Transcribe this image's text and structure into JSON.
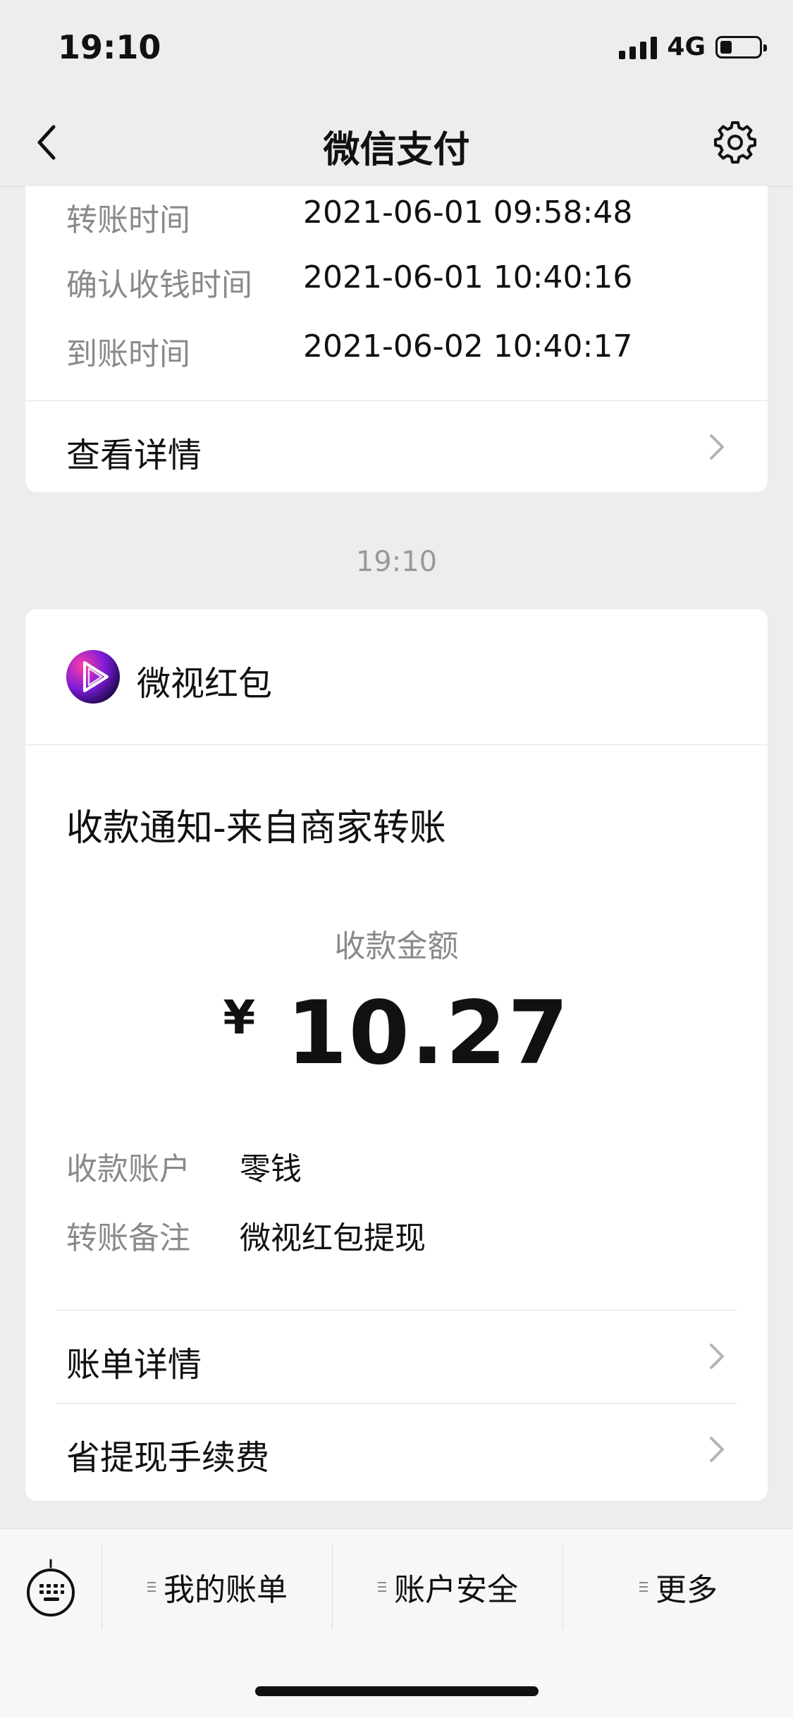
{
  "status_bar": {
    "time": "19:10",
    "network": "4G"
  },
  "nav": {
    "title": "微信支付"
  },
  "card1": {
    "partial_row": {
      "label": "转账时间",
      "value": "2021-06-01 09:58:48"
    },
    "rows": [
      {
        "label": "确认收钱时间",
        "value": "2021-06-01 10:40:16"
      },
      {
        "label": "到账时间",
        "value": "2021-06-02 10:40:17"
      }
    ],
    "link_label": "查看详情"
  },
  "timestamp": "19:10",
  "card2": {
    "brand": "微视红包",
    "notice_title": "收款通知-来自商家转账",
    "amount_label": "收款金额",
    "currency": "¥",
    "amount": "10.27",
    "details": [
      {
        "label": "收款账户",
        "value": "零钱"
      },
      {
        "label": "转账备注",
        "value": "微视红包提现"
      }
    ],
    "links": [
      {
        "label": "账单详情"
      },
      {
        "label": "省提现手续费"
      }
    ]
  },
  "bottom_bar": {
    "tabs": [
      {
        "label": "我的账单"
      },
      {
        "label": "账户安全"
      },
      {
        "label": "更多"
      }
    ]
  },
  "icons": {
    "back": "chevron-left-icon",
    "settings": "gear-icon",
    "chevron": "chevron-right-icon",
    "keyboard": "keyboard-icon",
    "menu": "menu-lines-icon"
  }
}
